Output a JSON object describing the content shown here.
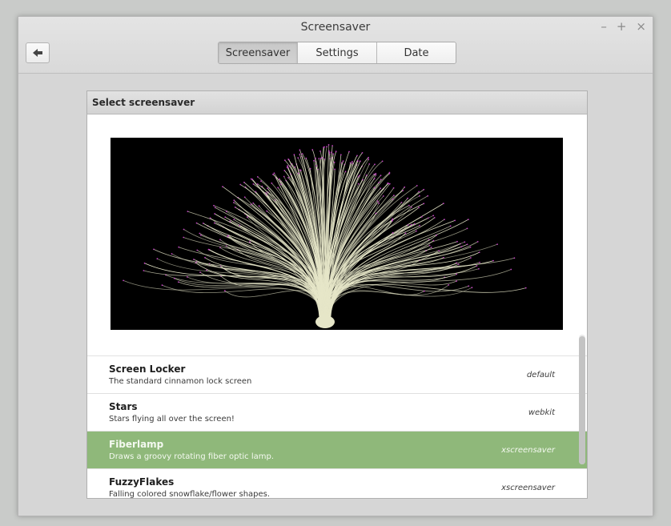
{
  "window": {
    "title": "Screensaver",
    "controls": {
      "minimize": "–",
      "maximize": "+",
      "close": "×"
    }
  },
  "tabs": [
    {
      "label": "Screensaver",
      "active": true
    },
    {
      "label": "Settings",
      "active": false
    },
    {
      "label": "Date",
      "active": false
    }
  ],
  "panel": {
    "header": "Select screensaver",
    "preview_name": "Fiberlamp"
  },
  "screensavers": [
    {
      "name": "Screen Locker",
      "description": "The standard cinnamon lock screen",
      "kind": "default",
      "selected": false
    },
    {
      "name": "Stars",
      "description": "Stars flying all over the screen!",
      "kind": "webkit",
      "selected": false
    },
    {
      "name": "Fiberlamp",
      "description": "Draws a groovy rotating fiber optic lamp.",
      "kind": "xscreensaver",
      "selected": true
    },
    {
      "name": "FuzzyFlakes",
      "description": "Falling colored snowflake/flower shapes.",
      "kind": "xscreensaver",
      "selected": false
    }
  ],
  "colors": {
    "selection": "#8fb87a",
    "preview_background": "#000000",
    "fiber": "#e6e6c8",
    "fiber_tip": "#c040c0"
  },
  "icons": {
    "back": "back-arrow-icon"
  }
}
